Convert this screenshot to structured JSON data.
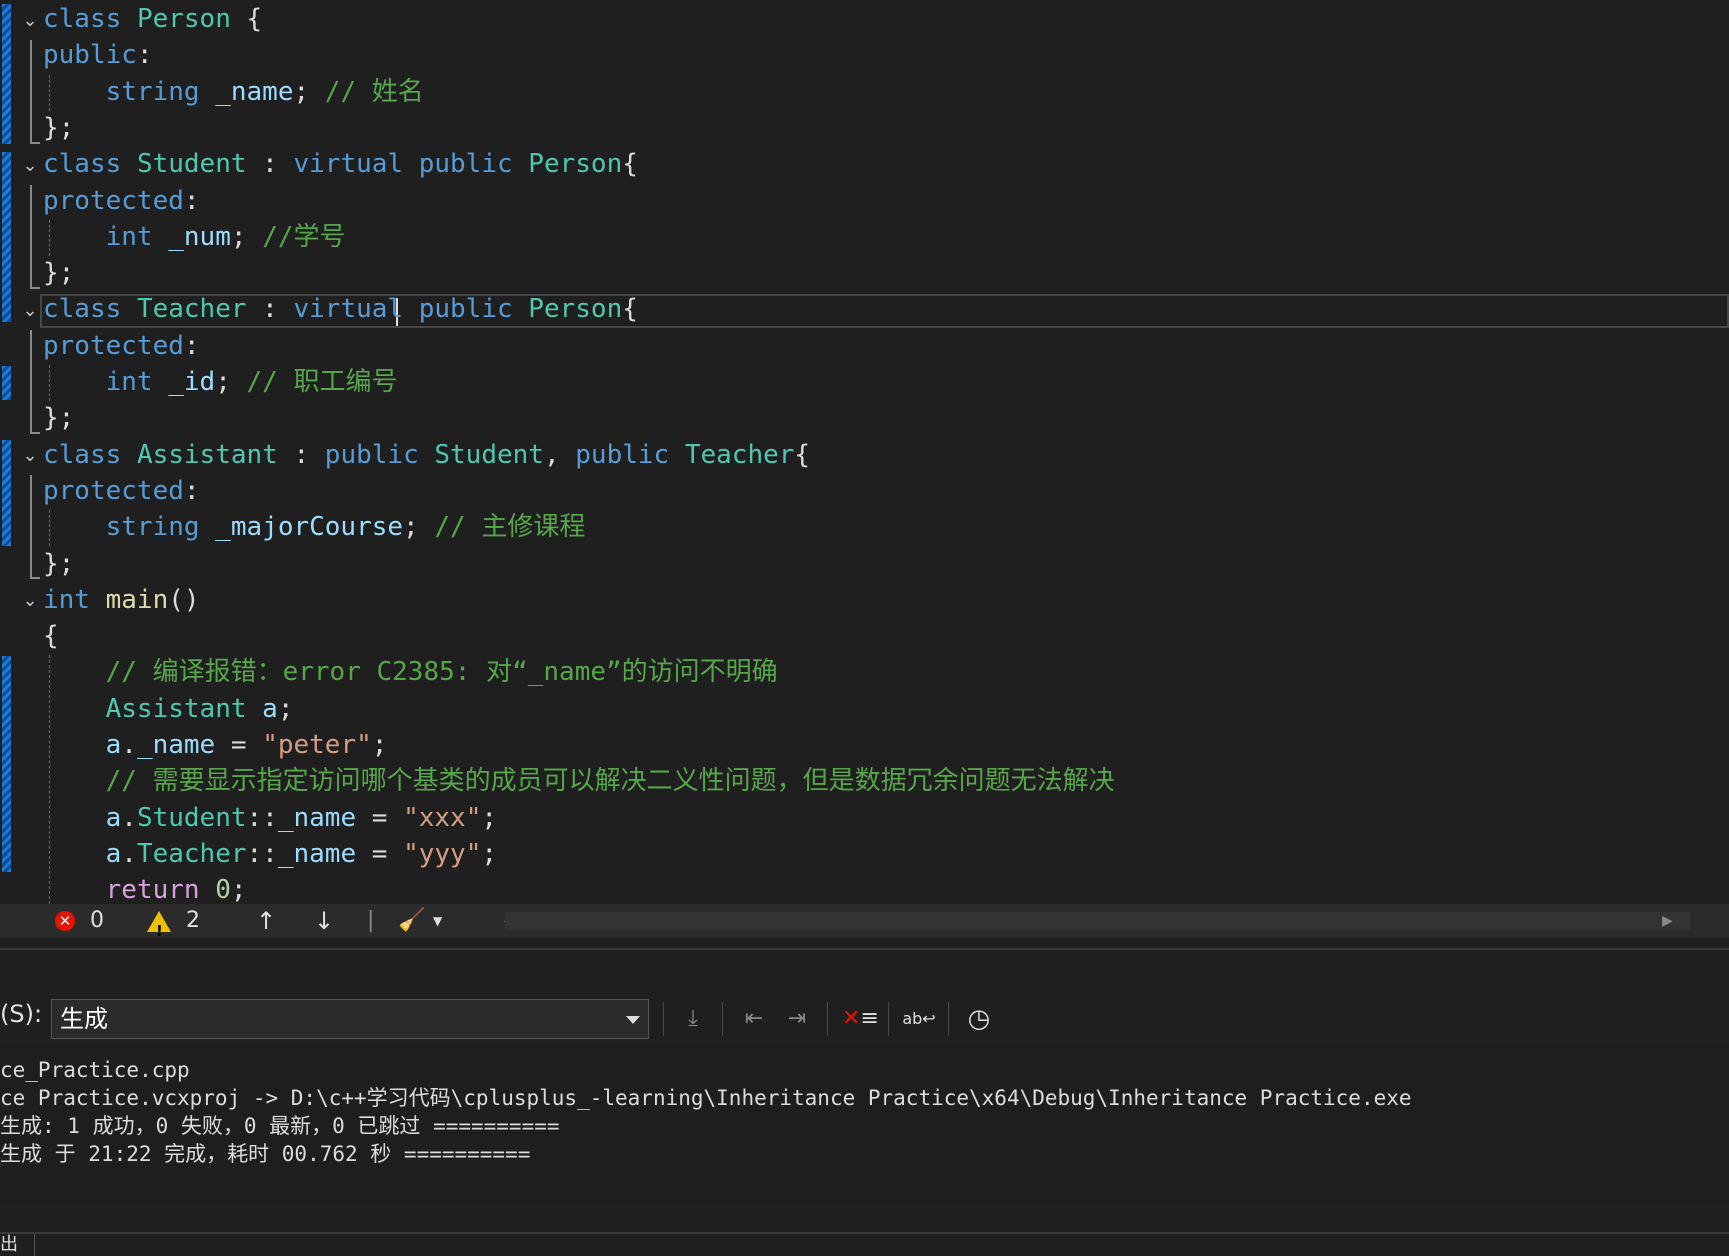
{
  "editor": {
    "lines": [
      {
        "segs": [
          [
            "kw",
            "class"
          ],
          [
            "pl",
            " "
          ],
          [
            "ty",
            "Person"
          ],
          [
            "pl",
            " {"
          ]
        ]
      },
      {
        "segs": [
          [
            "kw",
            "public"
          ],
          [
            "pl",
            ":"
          ]
        ]
      },
      {
        "segs": [
          [
            "pl",
            "    "
          ],
          [
            "kw",
            "string"
          ],
          [
            "pl",
            " "
          ],
          [
            "var",
            "_name"
          ],
          [
            "pl",
            "; "
          ],
          [
            "cm",
            "// 姓名"
          ]
        ]
      },
      {
        "segs": [
          [
            "pl",
            "};"
          ]
        ]
      },
      {
        "segs": [
          [
            "kw",
            "class"
          ],
          [
            "pl",
            " "
          ],
          [
            "ty",
            "Student"
          ],
          [
            "pl",
            " : "
          ],
          [
            "kw",
            "virtual"
          ],
          [
            "pl",
            " "
          ],
          [
            "kw",
            "public"
          ],
          [
            "pl",
            " "
          ],
          [
            "ty",
            "Person"
          ],
          [
            "pl",
            "{"
          ]
        ]
      },
      {
        "segs": [
          [
            "kw",
            "protected"
          ],
          [
            "pl",
            ":"
          ]
        ]
      },
      {
        "segs": [
          [
            "pl",
            "    "
          ],
          [
            "kw",
            "int"
          ],
          [
            "pl",
            " "
          ],
          [
            "var",
            "_num"
          ],
          [
            "pl",
            "; "
          ],
          [
            "cm",
            "//学号"
          ]
        ]
      },
      {
        "segs": [
          [
            "pl",
            "};"
          ]
        ]
      },
      {
        "segs": [
          [
            "kw",
            "class"
          ],
          [
            "pl",
            " "
          ],
          [
            "ty",
            "Teacher"
          ],
          [
            "pl",
            " : "
          ],
          [
            "kw",
            "virtual"
          ],
          [
            "pl",
            " "
          ],
          [
            "kw",
            "public"
          ],
          [
            "pl",
            " "
          ],
          [
            "ty",
            "Person"
          ],
          [
            "pl",
            "{"
          ]
        ]
      },
      {
        "segs": [
          [
            "kw",
            "protected"
          ],
          [
            "pl",
            ":"
          ]
        ]
      },
      {
        "segs": [
          [
            "pl",
            "    "
          ],
          [
            "kw",
            "int"
          ],
          [
            "pl",
            " "
          ],
          [
            "var",
            "_id"
          ],
          [
            "pl",
            "; "
          ],
          [
            "cm",
            "// 职工编号"
          ]
        ]
      },
      {
        "segs": [
          [
            "pl",
            "};"
          ]
        ]
      },
      {
        "segs": [
          [
            "kw",
            "class"
          ],
          [
            "pl",
            " "
          ],
          [
            "ty",
            "Assistant"
          ],
          [
            "pl",
            " : "
          ],
          [
            "kw",
            "public"
          ],
          [
            "pl",
            " "
          ],
          [
            "ty",
            "Student"
          ],
          [
            "pl",
            ", "
          ],
          [
            "kw",
            "public"
          ],
          [
            "pl",
            " "
          ],
          [
            "ty",
            "Teacher"
          ],
          [
            "pl",
            "{"
          ]
        ]
      },
      {
        "segs": [
          [
            "kw",
            "protected"
          ],
          [
            "pl",
            ":"
          ]
        ]
      },
      {
        "segs": [
          [
            "pl",
            "    "
          ],
          [
            "kw",
            "string"
          ],
          [
            "pl",
            " "
          ],
          [
            "var",
            "_majorCourse"
          ],
          [
            "pl",
            "; "
          ],
          [
            "cm",
            "// 主修课程"
          ]
        ]
      },
      {
        "segs": [
          [
            "pl",
            "};"
          ]
        ]
      },
      {
        "segs": [
          [
            "kw",
            "int"
          ],
          [
            "pl",
            " "
          ],
          [
            "mth",
            "main"
          ],
          [
            "pl",
            "()"
          ]
        ]
      },
      {
        "segs": [
          [
            "pl",
            "{"
          ]
        ]
      },
      {
        "segs": [
          [
            "pl",
            "    "
          ],
          [
            "cm",
            "// 编译报错：error C2385: 对“_name”的访问不明确"
          ]
        ]
      },
      {
        "segs": [
          [
            "pl",
            "    "
          ],
          [
            "ty",
            "Assistant"
          ],
          [
            "pl",
            " "
          ],
          [
            "var",
            "a"
          ],
          [
            "pl",
            ";"
          ]
        ]
      },
      {
        "segs": [
          [
            "pl",
            "    "
          ],
          [
            "var",
            "a"
          ],
          [
            "pl",
            "."
          ],
          [
            "var",
            "_name"
          ],
          [
            "pl",
            " = "
          ],
          [
            "st",
            "\"peter\""
          ],
          [
            "pl",
            ";"
          ]
        ]
      },
      {
        "segs": [
          [
            "pl",
            "    "
          ],
          [
            "cm",
            "// 需要显示指定访问哪个基类的成员可以解决二义性问题，但是数据冗余问题无法解决"
          ]
        ]
      },
      {
        "segs": [
          [
            "pl",
            "    "
          ],
          [
            "var",
            "a"
          ],
          [
            "pl",
            "."
          ],
          [
            "ty",
            "Student"
          ],
          [
            "pl",
            "::"
          ],
          [
            "var",
            "_name"
          ],
          [
            "pl",
            " = "
          ],
          [
            "st",
            "\"xxx\""
          ],
          [
            "pl",
            ";"
          ]
        ]
      },
      {
        "segs": [
          [
            "pl",
            "    "
          ],
          [
            "var",
            "a"
          ],
          [
            "pl",
            "."
          ],
          [
            "ty",
            "Teacher"
          ],
          [
            "pl",
            "::"
          ],
          [
            "var",
            "_name"
          ],
          [
            "pl",
            " = "
          ],
          [
            "st",
            "\"yyy\""
          ],
          [
            "pl",
            ";"
          ]
        ]
      },
      {
        "segs": [
          [
            "pl",
            "    "
          ],
          [
            "ctl",
            "return"
          ],
          [
            "pl",
            " "
          ],
          [
            "nm",
            "0"
          ],
          [
            "pl",
            ";"
          ]
        ]
      }
    ]
  },
  "status": {
    "errors": "0",
    "warnings": "2"
  },
  "output": {
    "show_label": "(S):",
    "source": "生成",
    "lines": [
      "ce_Practice.cpp",
      "ce Practice.vcxproj -> D:\\c++学习代码\\cplusplus_-learning\\Inheritance Practice\\x64\\Debug\\Inheritance Practice.exe",
      "生成: 1 成功，0 失败，0 最新，0 已跳过 ==========",
      "生成 于 21:22 完成，耗时 00.762 秒 =========="
    ]
  },
  "bottom_tab": "出"
}
